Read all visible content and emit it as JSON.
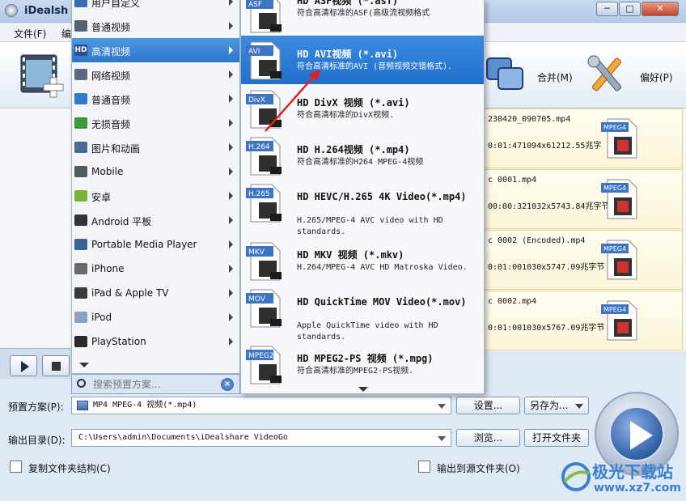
{
  "window": {
    "title": "iDealsh",
    "min": "─",
    "max": "□",
    "close": "✕"
  },
  "menubar": [
    {
      "label": "文件(F)"
    },
    {
      "label": "编"
    }
  ],
  "toolbar": {
    "merge_label": "合并(M)",
    "prefs_label": "偏好(P)"
  },
  "files": [
    {
      "name": "230420_090705.mp4",
      "info": "0:01:471094x61212.55兆字",
      "badge": "MPEG4"
    },
    {
      "name": "c 0001.mp4",
      "info": "00:00:321032x5743.84兆字节",
      "badge": "MPEG4"
    },
    {
      "name": "c 0002 (Encoded).mp4",
      "info": "0:01:001030x5747.09兆字节",
      "badge": "MPEG4"
    },
    {
      "name": "c 0002.mp4",
      "info": "0:01:001030x5767.09兆字节",
      "badge": "MPEG4"
    }
  ],
  "category_menu": {
    "items": [
      {
        "label": "用户自定义",
        "icon": "user-custom-icon",
        "color": "#3a6ab0"
      },
      {
        "label": "普通视频",
        "icon": "film-icon",
        "color": "#556070"
      },
      {
        "label": "高清视频",
        "icon": "hd-icon",
        "color": "#2c4f8c",
        "badge": "HD",
        "selected": true
      },
      {
        "label": "网络视频",
        "icon": "web-video-icon",
        "color": "#5a6a80"
      },
      {
        "label": "普通音频",
        "icon": "music-note-icon",
        "color": "#2f7bd6"
      },
      {
        "label": "无损音频",
        "icon": "lossless-music-icon",
        "color": "#3a9a3a"
      },
      {
        "label": "图片和动画",
        "icon": "picture-icon",
        "color": "#4a6a9a"
      },
      {
        "label": "Mobile",
        "icon": "mobile-phone-icon",
        "color": "#505860"
      },
      {
        "label": "安卓",
        "icon": "android-icon",
        "color": "#79b33a"
      },
      {
        "label": "Android 平板",
        "icon": "android-tablet-icon",
        "color": "#333333"
      },
      {
        "label": "Portable Media Player",
        "icon": "media-player-icon",
        "color": "#3d5f9a"
      },
      {
        "label": "iPhone",
        "icon": "iphone-icon",
        "color": "#6a6a6a"
      },
      {
        "label": "iPad & Apple TV",
        "icon": "ipad-icon",
        "color": "#3a3a3a"
      },
      {
        "label": "iPod",
        "icon": "ipod-icon",
        "color": "#8aa0c0"
      },
      {
        "label": "PlayStation",
        "icon": "playstation-icon",
        "color": "#2a2a2a"
      }
    ]
  },
  "search": {
    "placeholder": "搜索预置方案...",
    "clear": "×"
  },
  "format_menu": {
    "items": [
      {
        "badge": "ASF",
        "title": "HD ASF视频 (*.asf)",
        "desc": "符合高清标准的ASF(高级流视频格式",
        "selected": false
      },
      {
        "badge": "AVI",
        "title": "HD AVI视频 (*.avi)",
        "desc": "符合高清标准的AVI (音频视频交错格式).",
        "selected": true
      },
      {
        "badge": "DivX",
        "title": "HD DivX 视频 (*.avi)",
        "desc": "符合高清标准的DivX视频.",
        "selected": false
      },
      {
        "badge": "H.264",
        "title": "HD H.264视频 (*.mp4)",
        "desc": "符合高清标准的H264 MPEG-4视频",
        "selected": false
      },
      {
        "badge": "H.265",
        "title": "HD HEVC/H.265 4K Video(*.mp4)",
        "desc": "H.265/MPEG-4 AVC video with HD standards.",
        "selected": false
      },
      {
        "badge": "MKV",
        "title": "HD MKV 视频 (*.mkv)",
        "desc": "H.264/MPEG-4 AVC HD Matroska Video.",
        "selected": false
      },
      {
        "badge": "MOV",
        "title": "HD QuickTime MOV Video(*.mov)",
        "desc": "Apple QuickTime video with HD standards.",
        "selected": false
      },
      {
        "badge": "MPEG2",
        "title": "HD MPEG2-PS 视频 (*.mpg)",
        "desc": "符合高清标准的MPEG2-PS视频.",
        "selected": false
      }
    ]
  },
  "bottom": {
    "preset_label": "预置方案(P):",
    "preset_value": "MP4 MPEG-4 视频(*.mp4)",
    "settings_btn": "设置...",
    "saveas_btn": "另存为...",
    "output_label": "输出目录(D):",
    "output_value": "C:\\Users\\admin\\Documents\\iDealshare VideoGo",
    "browse_btn": "浏览...",
    "open_folder_btn": "打开文件夹",
    "copy_structure_label": "复制文件夹结构(C)",
    "output_to_source_label": "输出到源文件夹(O)"
  },
  "watermark": {
    "text": "极光下载站",
    "url": "www.xz7.com"
  },
  "colors": {
    "accent": "#2b76cf",
    "annotation_arrow": "#e02020"
  }
}
